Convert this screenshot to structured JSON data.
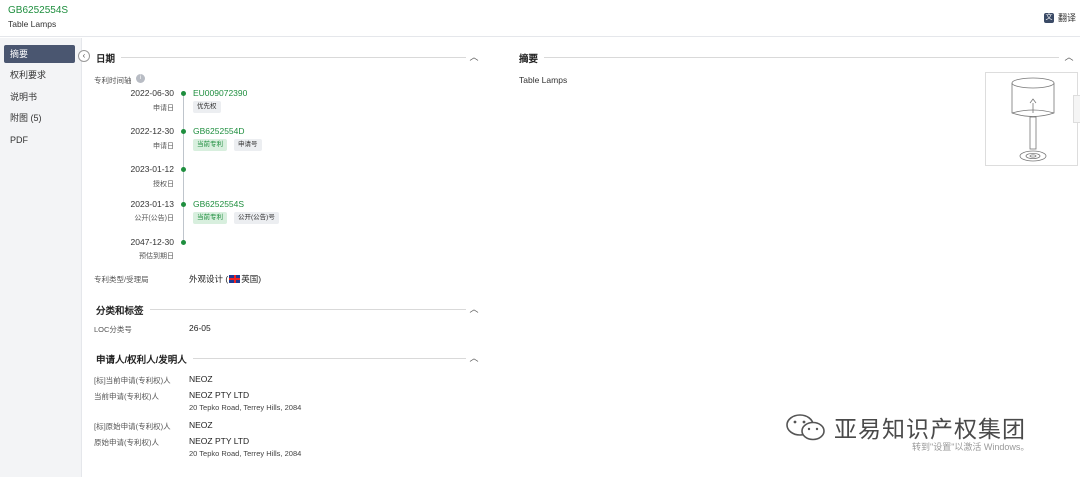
{
  "header": {
    "patent_number": "GB6252554S",
    "title": "Table Lamps",
    "translate_label": "翻译"
  },
  "sidebar": {
    "items": [
      {
        "label": "摘要",
        "active": true
      },
      {
        "label": "权利要求",
        "active": false
      },
      {
        "label": "说明书",
        "active": false
      },
      {
        "label": "附图 (5)",
        "active": false
      },
      {
        "label": "PDF",
        "active": false
      }
    ]
  },
  "dates_section": {
    "title": "日期",
    "timeline_label": "专利时间轴",
    "timeline": [
      {
        "date": "2022-06-30",
        "sub": "申请日",
        "link": "EU009072390",
        "tags": [
          "优先权"
        ]
      },
      {
        "date": "2022-12-30",
        "sub": "申请日",
        "link": "GB6252554D",
        "tags": [
          "当前专利",
          "申请号"
        ]
      },
      {
        "date": "2023-01-12",
        "sub": "授权日",
        "link": "",
        "tags": []
      },
      {
        "date": "2023-01-13",
        "sub": "公开(公告)日",
        "link": "GB6252554S",
        "tags": [
          "当前专利",
          "公开(公告)号"
        ]
      },
      {
        "date": "2047-12-30",
        "sub": "预估到期日",
        "link": "",
        "tags": []
      }
    ],
    "type_label": "专利类型/受理局",
    "type_value": "外观设计 (",
    "country": "英国",
    "type_close": ")"
  },
  "classification_section": {
    "title": "分类和标签",
    "loc_label": "LOC分类号",
    "loc_value": "26-05"
  },
  "applicant_section": {
    "title": "申请人/权利人/发明人",
    "rows": [
      {
        "label": "[标]当前申请(专利权)人",
        "value": "NEOZ",
        "address": ""
      },
      {
        "label": "当前申请(专利权)人",
        "value": "NEOZ PTY LTD",
        "address": "20 Tepko Road, Terrey Hills, 2084"
      },
      {
        "label": "[标]原始申请(专利权)人",
        "value": "NEOZ",
        "address": ""
      },
      {
        "label": "原始申请(专利权)人",
        "value": "NEOZ PTY LTD",
        "address": "20 Tepko Road, Terrey Hills, 2084"
      }
    ]
  },
  "abstract_section": {
    "title": "摘要",
    "text": "Table Lamps"
  },
  "overlay": {
    "watermark": "亚易知识产权集团",
    "activate_text": "转到\"设置\"以激活 Windows。"
  }
}
